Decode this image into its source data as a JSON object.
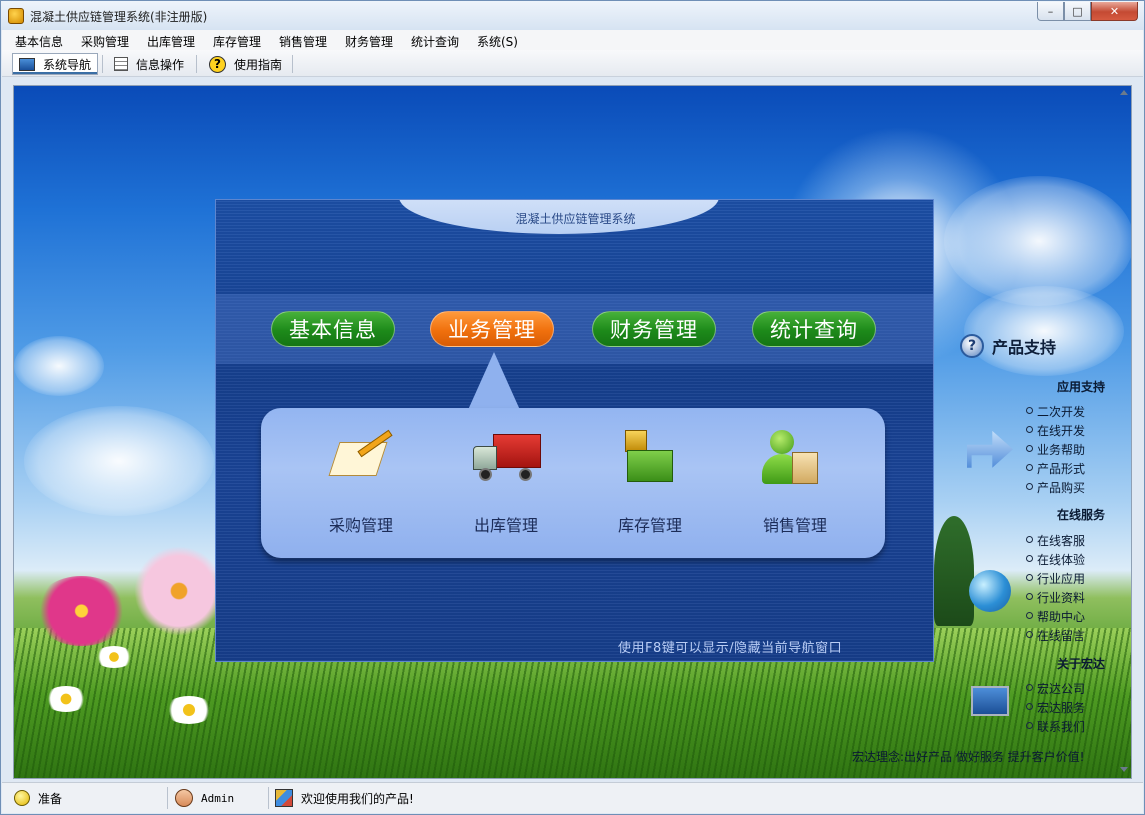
{
  "window": {
    "title": "混凝土供应链管理系统(非注册版)",
    "controls": {
      "minimize": "–",
      "maximize": "□",
      "close": "✕"
    }
  },
  "menu": {
    "items": [
      "基本信息",
      "采购管理",
      "出库管理",
      "库存管理",
      "销售管理",
      "财务管理",
      "统计查询",
      "系统(S)"
    ]
  },
  "toolbar": {
    "items": [
      {
        "label": "系统导航",
        "icon": "monitor-icon"
      },
      {
        "label": "信息操作",
        "icon": "grid-icon"
      },
      {
        "label": "使用指南",
        "icon": "help-icon"
      }
    ]
  },
  "nav_panel": {
    "title": "混凝土供应链管理系统",
    "categories": [
      "基本信息",
      "业务管理",
      "财务管理",
      "统计查询"
    ],
    "active_category": "业务管理",
    "sub_items": [
      "采购管理",
      "出库管理",
      "库存管理",
      "销售管理"
    ],
    "hint": "使用F8键可以显示/隐藏当前导航窗口"
  },
  "support": {
    "title": "产品支持",
    "sections": [
      {
        "title": "应用支持",
        "links": [
          "二次开发",
          "在线开发",
          "业务帮助",
          "产品形式",
          "产品购买"
        ]
      },
      {
        "title": "在线服务",
        "links": [
          "在线客服",
          "在线体验",
          "行业应用",
          "行业资料",
          "帮助中心",
          "在线留言"
        ]
      },
      {
        "title": "关于宏达",
        "links": [
          "宏达公司",
          "宏达服务",
          "联系我们"
        ]
      }
    ],
    "slogan": "宏达理念:出好产品 做好服务 提升客户价值!"
  },
  "status": {
    "ready": "准备",
    "user": "Admin",
    "message": "欢迎使用我们的产品!"
  },
  "colors": {
    "pill_active": "#f0700d",
    "pill_inactive": "#1d8a1a",
    "panel_bg": "#163f8e",
    "subpanel_bg": "#a9c4f4"
  }
}
